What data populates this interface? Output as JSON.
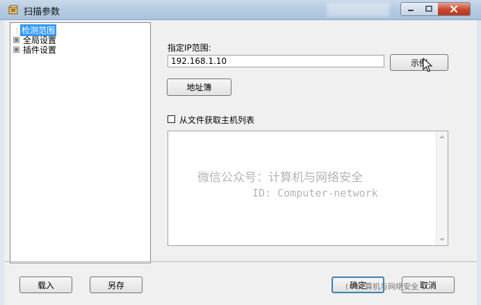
{
  "window": {
    "title": "扫描参数"
  },
  "tree": {
    "items": [
      {
        "label": "检测范围",
        "selected": true
      },
      {
        "label": "全局设置",
        "expander": "⊞"
      },
      {
        "label": "插件设置",
        "expander": "⊞"
      }
    ]
  },
  "form": {
    "ip_label": "指定IP范围:",
    "ip_value": "192.168.1.10",
    "example_button": "示例",
    "address_book_button": "地址簿",
    "file_checkbox_label": "从文件获取主机列表",
    "file_checkbox_checked": false
  },
  "watermark": {
    "line1": "微信公众号：计算机与网络安全",
    "line2": "ID: Computer-network"
  },
  "footer": {
    "load_button": "载入",
    "save_as_button": "另存",
    "ok_button": "确定",
    "cancel_button": "取消",
    "corner_text": "(✓ 计算机与网络安全"
  },
  "colors": {
    "selection": "#3399ff",
    "close_button": "#c8452b"
  }
}
